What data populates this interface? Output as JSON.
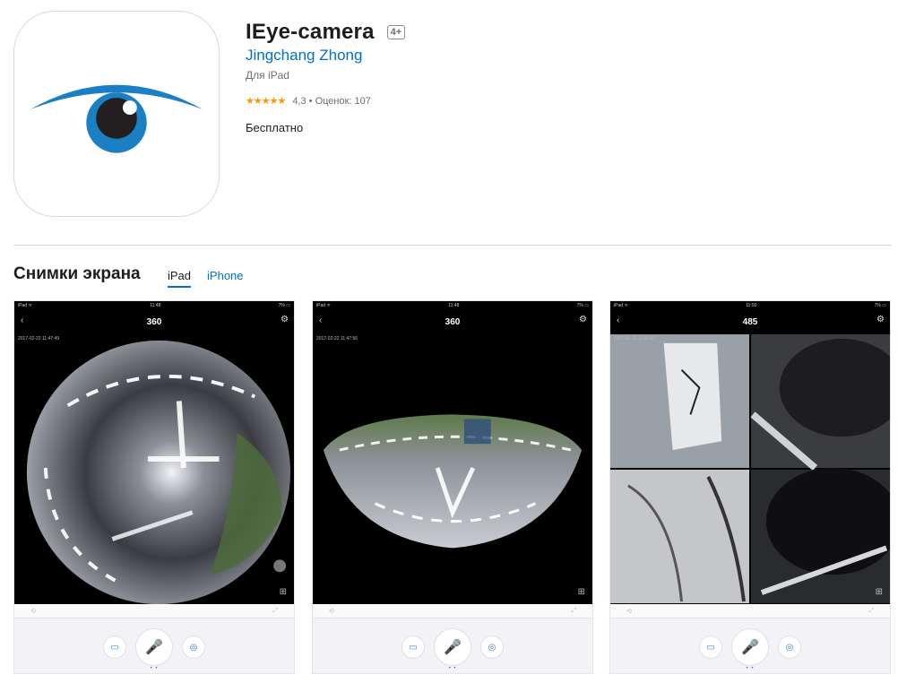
{
  "app": {
    "title": "IEye-camera",
    "age_rating": "4+",
    "developer": "Jingchang Zhong",
    "device": "Для iPad",
    "stars": "★★★★★",
    "rating_text": "4,3 • Оценок: 107",
    "price": "Бесплатно",
    "icon_name": "eye-logo-icon",
    "colors": {
      "eye_blue": "#1b7fc4",
      "link": "#0070c9",
      "stars": "#ff9500"
    }
  },
  "screenshots": {
    "title": "Снимки экрана",
    "tabs": [
      {
        "label": "iPad"
      },
      {
        "label": "iPhone"
      }
    ],
    "items": [
      {
        "status_left": "iPad ᯤ",
        "status_time": "11:48",
        "status_right": "7% ▭",
        "nav_title": "360",
        "timestamp": "2017-02-22 11:47:49",
        "view": "fisheye"
      },
      {
        "status_left": "iPad ᯤ",
        "status_time": "11:48",
        "status_right": "7% ▭",
        "nav_title": "360",
        "timestamp": "2017-02-22 11:47:56",
        "view": "bowl"
      },
      {
        "status_left": "iPad ᯤ",
        "status_time": "11:50",
        "status_right": "7% ▭",
        "nav_title": "485",
        "timestamp": "2017-02-22 11:50:27",
        "view": "quad"
      }
    ],
    "icons": {
      "back": "‹",
      "settings": "⚙",
      "grid": "⊞",
      "video": "▭",
      "mic": "🎤",
      "camera": "◎",
      "dots": "• •",
      "rotate": "⟲",
      "expand": "⤢"
    }
  }
}
